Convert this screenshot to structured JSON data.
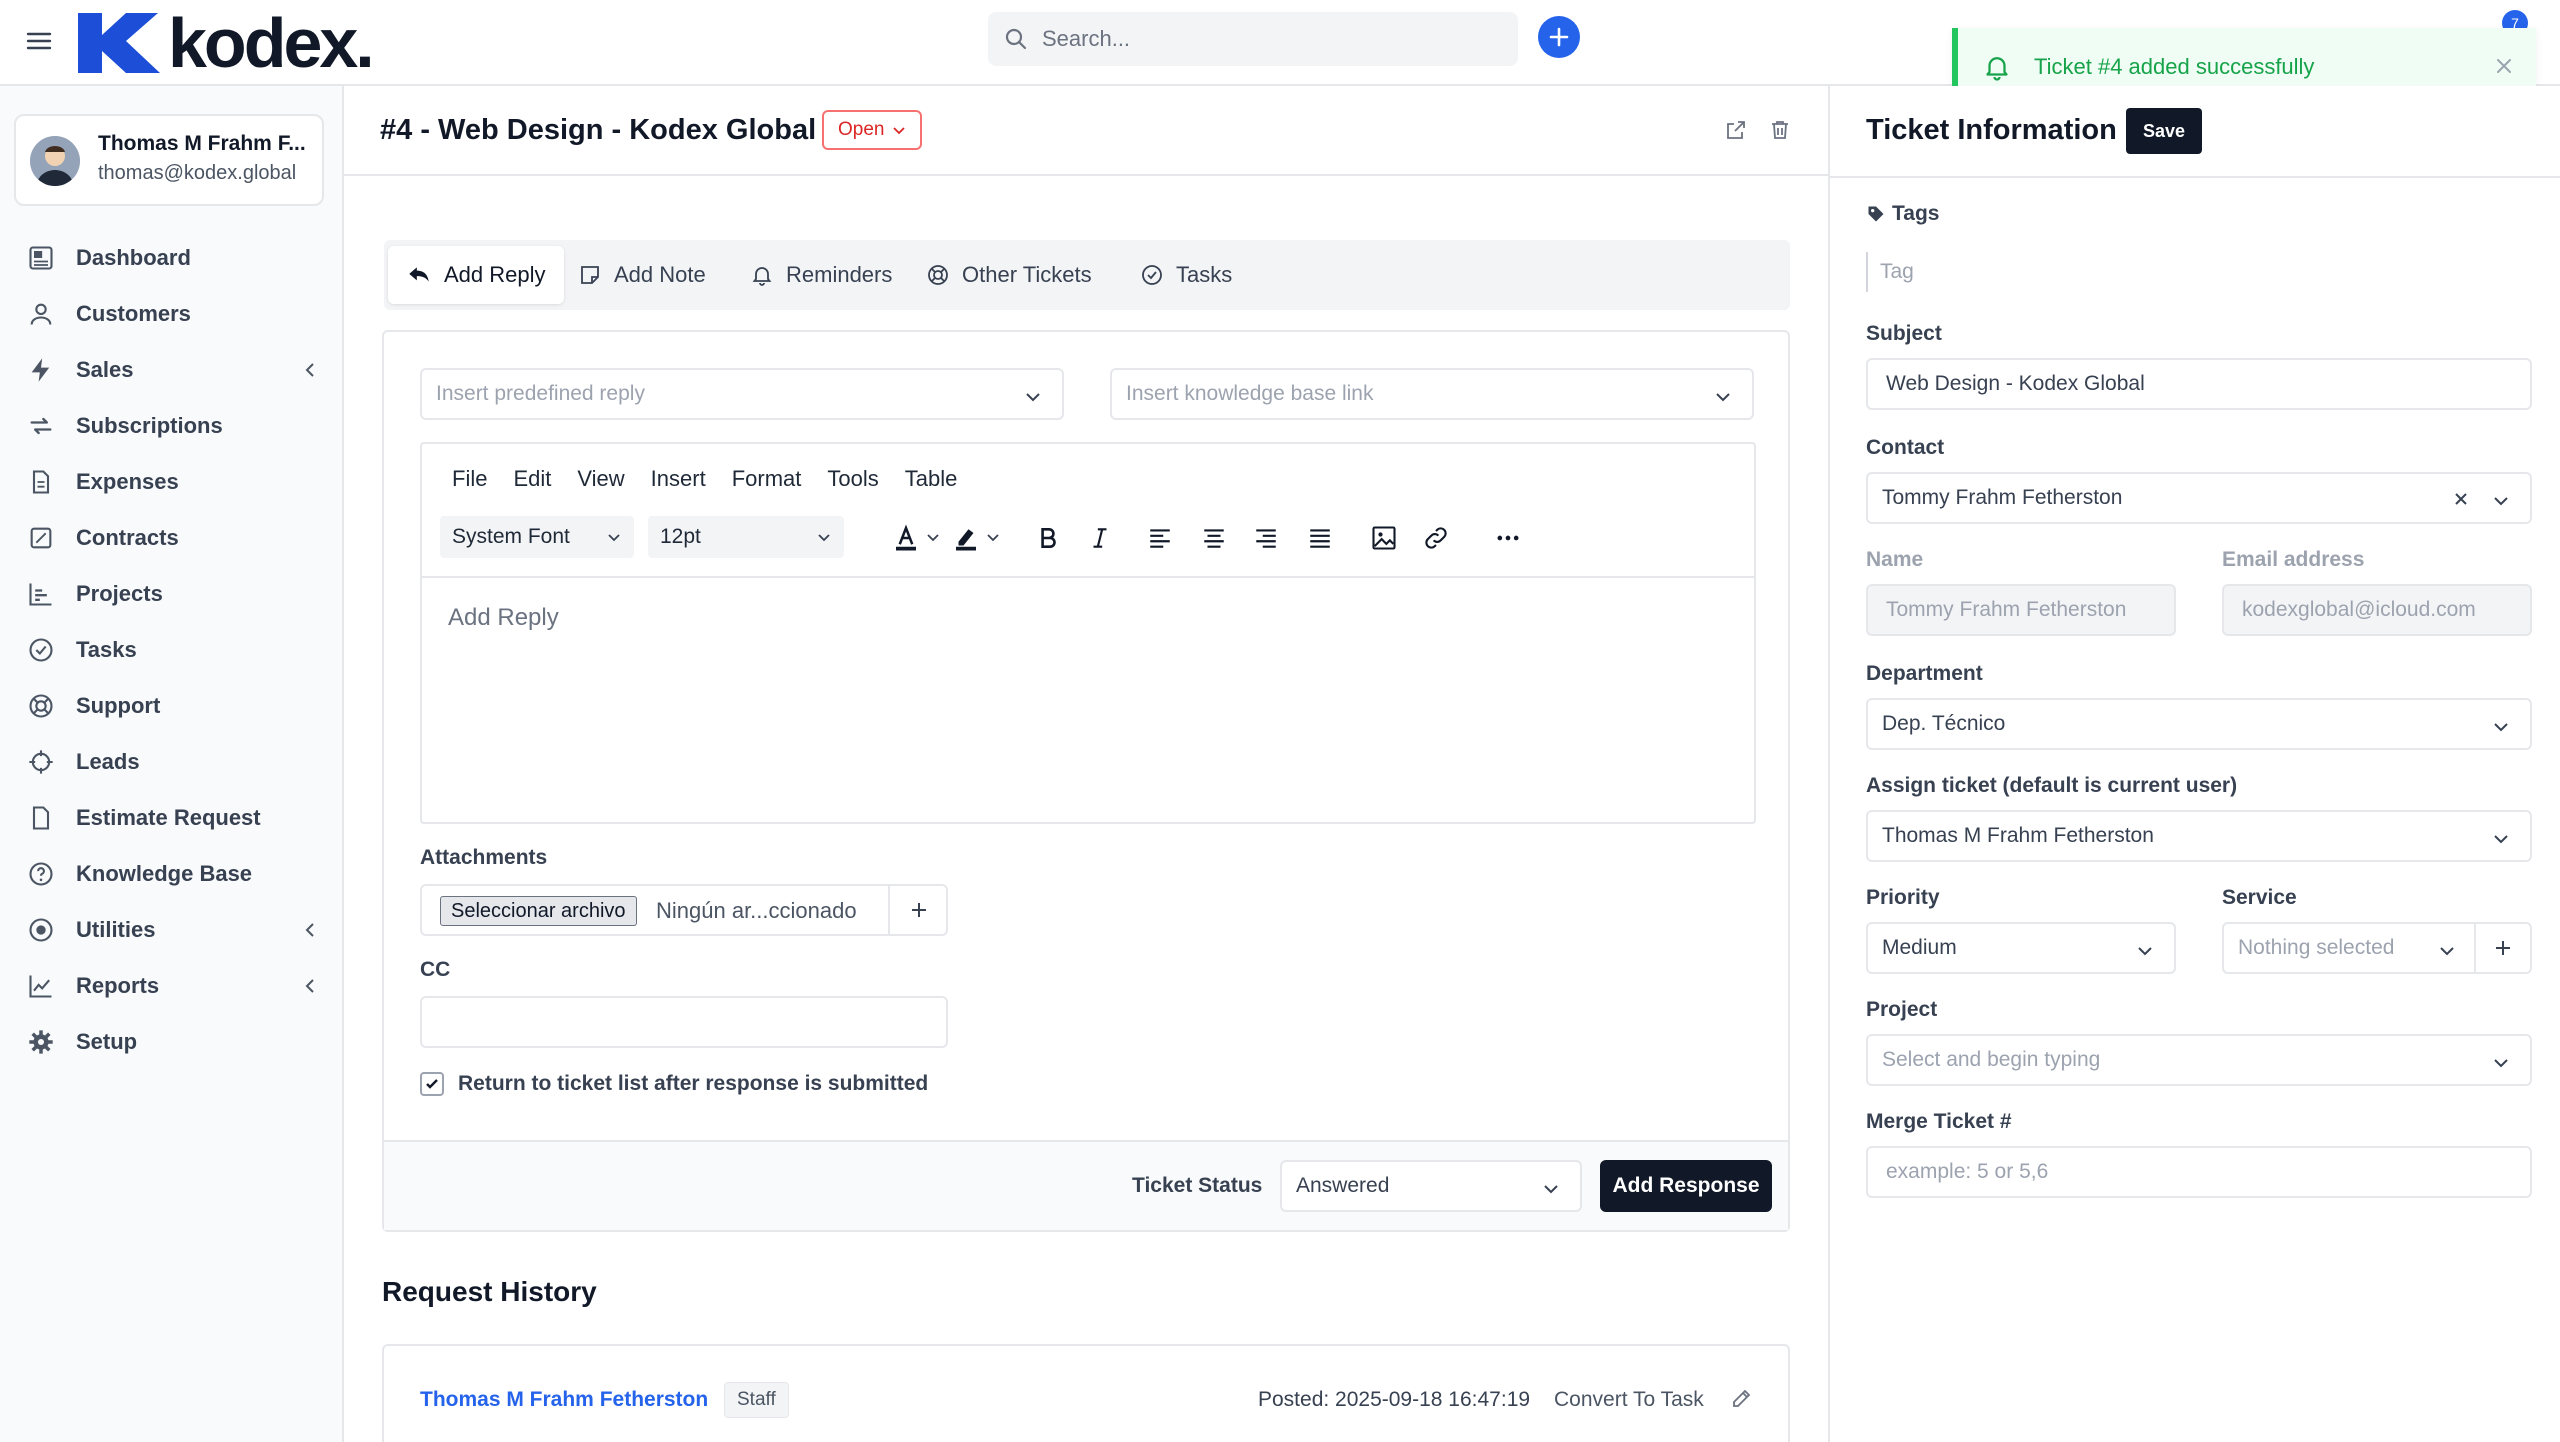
{
  "topbar": {
    "logo_text": "kodex.",
    "search_placeholder": "Search...",
    "notification_count": "7"
  },
  "toast": {
    "message": "Ticket #4 added successfully"
  },
  "sidebar": {
    "user_name": "Thomas M Frahm F...",
    "user_email": "thomas@kodex.global",
    "items": [
      {
        "label": "Dashboard",
        "icon": "dashboard-icon"
      },
      {
        "label": "Customers",
        "icon": "user-icon"
      },
      {
        "label": "Sales",
        "icon": "bolt-icon"
      },
      {
        "label": "Subscriptions",
        "icon": "refresh-icon"
      },
      {
        "label": "Expenses",
        "icon": "document-icon"
      },
      {
        "label": "Contracts",
        "icon": "contract-icon"
      },
      {
        "label": "Projects",
        "icon": "chart-bar-icon"
      },
      {
        "label": "Tasks",
        "icon": "check-circle-icon"
      },
      {
        "label": "Support",
        "icon": "lifebuoy-icon"
      },
      {
        "label": "Leads",
        "icon": "crosshair-icon"
      },
      {
        "label": "Estimate Request",
        "icon": "file-icon"
      },
      {
        "label": "Knowledge Base",
        "icon": "question-circle-icon"
      },
      {
        "label": "Utilities",
        "icon": "record-icon"
      },
      {
        "label": "Reports",
        "icon": "line-chart-icon"
      },
      {
        "label": "Setup",
        "icon": "gear-icon"
      }
    ]
  },
  "ticket": {
    "title": "#4 - Web Design - Kodex Global",
    "status": "Open"
  },
  "tabs": [
    {
      "label": "Add Reply"
    },
    {
      "label": "Add Note"
    },
    {
      "label": "Reminders"
    },
    {
      "label": "Other Tickets"
    },
    {
      "label": "Tasks"
    }
  ],
  "reply": {
    "predefined_placeholder": "Insert predefined reply",
    "kb_placeholder": "Insert knowledge base link",
    "editor_menu": [
      "File",
      "Edit",
      "View",
      "Insert",
      "Format",
      "Tools",
      "Table"
    ],
    "font_family": "System Font",
    "font_size": "12pt",
    "editor_placeholder": "Add Reply",
    "attachments_label": "Attachments",
    "file_button": "Seleccionar archivo",
    "file_name": "Ningún ar...ccionado",
    "cc_label": "CC",
    "return_label": "Return to ticket list after response is submitted",
    "ticket_status_label": "Ticket Status",
    "ticket_status_value": "Answered",
    "add_response": "Add Response"
  },
  "history": {
    "title": "Request History",
    "author": "Thomas M Frahm Fetherston",
    "role": "Staff",
    "posted": "Posted: 2025-09-18 16:47:19",
    "convert": "Convert To Task"
  },
  "info": {
    "title": "Ticket Information",
    "save": "Save",
    "tags_label": "Tags",
    "tag_placeholder": "Tag",
    "subject_label": "Subject",
    "subject_value": "Web Design - Kodex Global",
    "contact_label": "Contact",
    "contact_value": "Tommy Frahm Fetherston",
    "name_label": "Name",
    "name_value": "Tommy  Frahm Fetherston",
    "email_label": "Email address",
    "email_value": "kodexglobal@icloud.com",
    "department_label": "Department",
    "department_value": "Dep. Técnico",
    "assign_label": "Assign ticket (default is current user)",
    "assign_value": "Thomas M Frahm Fetherston",
    "priority_label": "Priority",
    "priority_value": "Medium",
    "service_label": "Service",
    "service_value": "Nothing selected",
    "project_label": "Project",
    "project_placeholder": "Select and begin typing",
    "merge_label": "Merge Ticket #",
    "merge_placeholder": "example: 5 or 5,6"
  },
  "colors": {
    "accent": "#2563eb",
    "success": "#22c55e",
    "danger": "#dc2626",
    "dark": "#111827"
  }
}
